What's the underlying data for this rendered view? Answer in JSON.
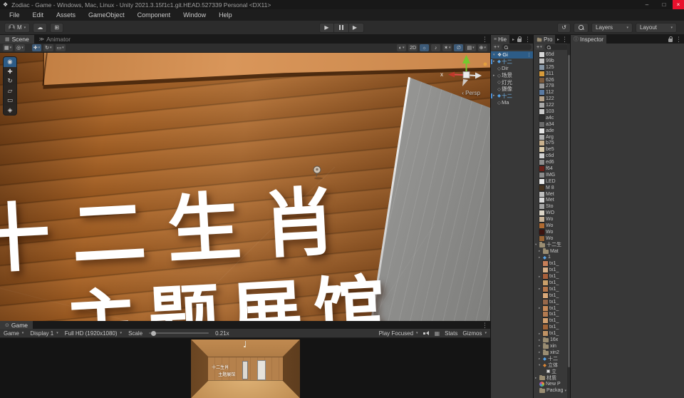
{
  "window": {
    "title": "Zodiac - Game - Windows, Mac, Linux - Unity 2021.3.15f1c1.git.HEAD.527339 Personal <DX11>"
  },
  "menubar": {
    "items": [
      "File",
      "Edit",
      "Assets",
      "GameObject",
      "Component",
      "Window",
      "Help"
    ]
  },
  "toolbar": {
    "account_initial": "M",
    "layers": "Layers",
    "layout": "Layout"
  },
  "icons": {
    "unity": "❖",
    "win_min": "–",
    "win_max": "□",
    "win_close": "×",
    "play": "▶",
    "history": "↺",
    "cloud": "☁",
    "services": "⊞",
    "dropdown": "▾",
    "more": "⋮",
    "arrow_right": "▸",
    "arrow_down": "▾",
    "scene_tab": "▦",
    "animator_tab": "≫",
    "game_tab": "⊙",
    "hierarchy_tab": "≡",
    "inspector_tab": "ⓘ",
    "plus": "+",
    "grid_snap": "▦",
    "pivot": "◎",
    "move": "✚",
    "rotate": "↻",
    "rect": "▭",
    "shading": "◐",
    "light": "☼",
    "audio": "♪",
    "effects": "✶",
    "visibility": "∅",
    "camera": "▤",
    "component": "⊕",
    "view": "◉",
    "scale": "▱",
    "transform": "◈",
    "prefab": "◆",
    "gameobject": "◇",
    "vsync_grid": "▦"
  },
  "scene": {
    "tabs": [
      "Scene",
      "Animator"
    ],
    "axis_x": "x",
    "persp": "‹ Persp",
    "banner_line1": "十二生肖",
    "banner_line2": "主题展馆"
  },
  "scene_toolbar": {
    "group1": [
      {
        "icon": "grid_snap",
        "dd": true
      },
      {
        "icon": "pivot",
        "dd": true
      }
    ],
    "group2": [
      {
        "icon": "move",
        "dd": true,
        "active": true
      },
      {
        "icon": "rotate",
        "dd": true
      },
      {
        "icon": "rect",
        "dd": true
      }
    ],
    "right": [
      {
        "icon": "shading",
        "dd": true
      },
      {
        "label": "2D"
      },
      {
        "icon": "light",
        "active": true
      },
      {
        "icon": "audio"
      },
      {
        "icon": "effects",
        "dd": true
      },
      {
        "icon": "visibility",
        "active": true
      },
      {
        "icon": "camera",
        "dd": true
      },
      {
        "icon": "component",
        "dd": true
      }
    ]
  },
  "tool_palette": [
    {
      "tool": "view",
      "active": true
    },
    {
      "tool": "move"
    },
    {
      "tool": "rotate"
    },
    {
      "tool": "scale"
    },
    {
      "tool": "rect"
    },
    {
      "tool": "transform"
    }
  ],
  "hierarchy": {
    "tab": "Hie",
    "rows": [
      {
        "label": "Gi",
        "icon": "unity",
        "arrow": "down",
        "selected": true,
        "more": true
      },
      {
        "label": "十二",
        "icon": "prefab",
        "arrow": "right",
        "mark": true
      },
      {
        "label": "Dir",
        "icon": "gameobject"
      },
      {
        "label": "场景",
        "icon": "gameobject",
        "arrow": "right"
      },
      {
        "label": "灯光",
        "icon": "gameobject"
      },
      {
        "label": "摄像",
        "icon": "gameobject"
      },
      {
        "label": "十二",
        "icon": "prefab",
        "arrow": "right",
        "mark": true
      },
      {
        "label": "Ma",
        "icon": "gameobject"
      }
    ]
  },
  "project": {
    "tab": "Pro",
    "items": [
      {
        "label": "65d",
        "type": "tex",
        "color": "#d8d8d8"
      },
      {
        "label": "99b",
        "type": "tex",
        "color": "#c4c4c4"
      },
      {
        "label": "125",
        "type": "tex",
        "color": "#8696a6"
      },
      {
        "label": "311",
        "type": "tex",
        "color": "#d79b3a"
      },
      {
        "label": "626",
        "type": "tex",
        "color": "#7b5a3c"
      },
      {
        "label": "278",
        "type": "tex",
        "color": "#9a9a9a"
      },
      {
        "label": "112",
        "type": "tex",
        "color": "#5a7aa2"
      },
      {
        "label": "122",
        "type": "tex",
        "color": "#b3a089"
      },
      {
        "label": "122",
        "type": "tex",
        "color": "#a8a8a8"
      },
      {
        "label": "103",
        "type": "tex",
        "color": "#cacaca"
      },
      {
        "label": "a4c",
        "type": "tex",
        "color": "#2e2e2e"
      },
      {
        "label": "a34",
        "type": "tex",
        "color": "#6a6a6a"
      },
      {
        "label": "ade",
        "type": "tex",
        "color": "#e6e6e6"
      },
      {
        "label": "Arg",
        "type": "tex",
        "color": "#b0b0b0"
      },
      {
        "label": "b75",
        "type": "tex",
        "color": "#c9b18d"
      },
      {
        "label": "be5",
        "type": "tex",
        "color": "#d9c9a9"
      },
      {
        "label": "c6d",
        "type": "tex",
        "color": "#d2d2d2"
      },
      {
        "label": "ed6",
        "type": "tex",
        "color": "#8e8e8e"
      },
      {
        "label": "f64",
        "type": "tex",
        "color": "#6a2018"
      },
      {
        "label": "IMG",
        "type": "tex",
        "color": "#8a8a8a"
      },
      {
        "label": "LED",
        "type": "tex",
        "color": "#ececec"
      },
      {
        "label": "M 8",
        "type": "tex",
        "color": "#46331f"
      },
      {
        "label": "Met",
        "type": "tex",
        "color": "#bdbdbd"
      },
      {
        "label": "Met",
        "type": "tex",
        "color": "#dcdcdc"
      },
      {
        "label": "Sto",
        "type": "tex",
        "color": "#a4a4a4"
      },
      {
        "label": "WO",
        "type": "tex",
        "color": "#ddd6c8"
      },
      {
        "label": "Wo",
        "type": "tex",
        "color": "#c8b296"
      },
      {
        "label": "Wo",
        "type": "tex",
        "color": "#b06a30"
      },
      {
        "label": "Wo",
        "type": "tex",
        "color": "#3c1410"
      },
      {
        "label": "Wo",
        "type": "tex",
        "color": "#9a6434"
      },
      {
        "label": "十二生",
        "type": "folder",
        "arrow": "down"
      },
      {
        "label": "Mat",
        "type": "folder",
        "indent": 1,
        "arrow": "right"
      },
      {
        "label": "1",
        "type": "prefab",
        "indent": 1,
        "arrow": "right"
      },
      {
        "label": "tx1_",
        "type": "tex",
        "color": "#c87f58",
        "indent": 1
      },
      {
        "label": "tx1_",
        "type": "tex",
        "color": "#d8b088",
        "indent": 1
      },
      {
        "label": "tx1_",
        "type": "tex",
        "color": "#a85f3a",
        "indent": 1,
        "arrow": "right"
      },
      {
        "label": "tx1_",
        "type": "tex",
        "color": "#caa06a",
        "indent": 1
      },
      {
        "label": "tx1_",
        "type": "tex",
        "color": "#b5764a",
        "indent": 1,
        "arrow": "right"
      },
      {
        "label": "tx1_",
        "type": "tex",
        "color": "#d9a878",
        "indent": 1
      },
      {
        "label": "tx1_",
        "type": "tex",
        "color": "#97684a",
        "indent": 1
      },
      {
        "label": "tx1_",
        "type": "tex",
        "color": "#c88a58",
        "indent": 1,
        "arrow": "right"
      },
      {
        "label": "tx1_",
        "type": "tex",
        "color": "#b27a50",
        "indent": 1
      },
      {
        "label": "tx1_",
        "type": "tex",
        "color": "#d2a070",
        "indent": 1
      },
      {
        "label": "tx1_",
        "type": "tex",
        "color": "#a06438",
        "indent": 1
      },
      {
        "label": "tx1_",
        "type": "tex",
        "color": "#c09263",
        "indent": 1,
        "arrow": "right"
      },
      {
        "label": "16x",
        "type": "folder",
        "indent": 1,
        "arrow": "right"
      },
      {
        "label": "xin",
        "type": "folder",
        "indent": 1,
        "arrow": "right"
      },
      {
        "label": "xin2",
        "type": "folder",
        "indent": 1,
        "arrow": "right"
      },
      {
        "label": "十二",
        "type": "prefab",
        "indent": 1,
        "arrow": "right"
      },
      {
        "label": "立体",
        "type": "model",
        "indent": 1,
        "arrow": "down"
      },
      {
        "label": "立",
        "type": "sub",
        "indent": 2
      },
      {
        "label": "材质",
        "type": "folder",
        "arrow": "right"
      },
      {
        "label": "New P",
        "type": "shader"
      },
      {
        "label": "Packag",
        "type": "folder",
        "trail": "▾"
      }
    ]
  },
  "inspector": {
    "tab": "Inspector"
  },
  "game": {
    "tab": "Game",
    "view_dropdown": "Game",
    "display": "Display 1",
    "resolution": "Full HD (1920x1080)",
    "scale_label": "Scale",
    "scale_value": "0.21x",
    "play_focused": "Play Focused",
    "stats": "Stats",
    "gizmos": "Gizmos",
    "preview_line1": "十二生肖",
    "preview_line2": "主题展馆"
  }
}
